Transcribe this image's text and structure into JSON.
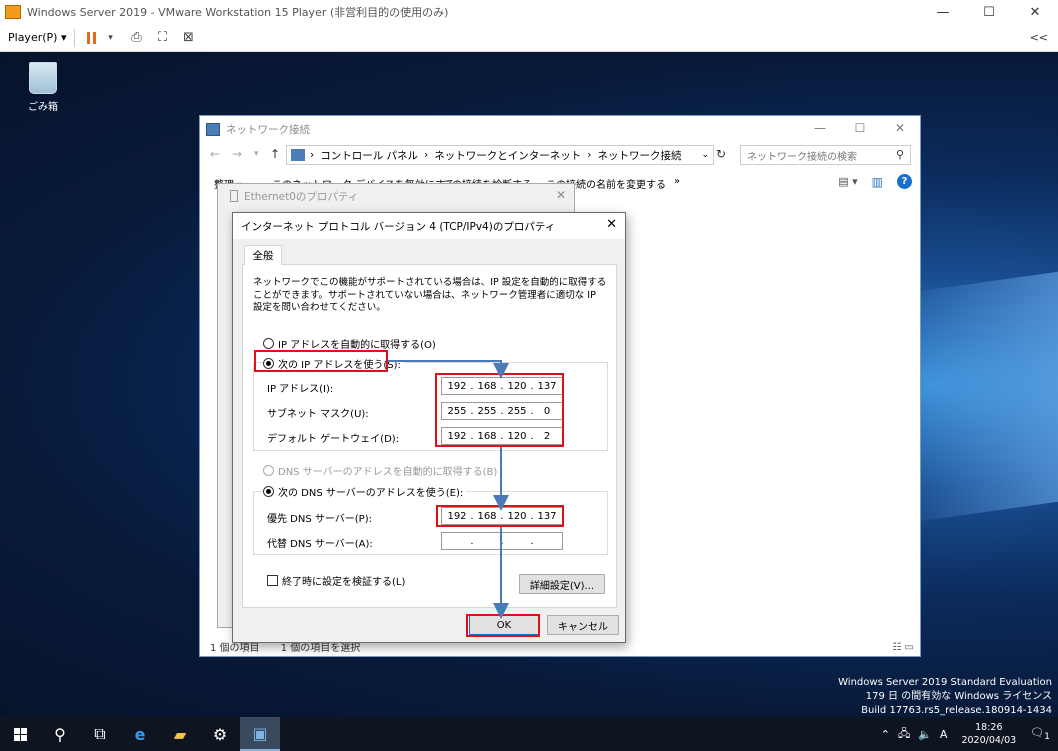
{
  "vmware": {
    "title": "Windows Server 2019 - VMware Workstation 15 Player (非営利目的の使用のみ)",
    "player_menu": "Player(P)",
    "window_controls": [
      "—",
      "☐",
      "✕"
    ],
    "collapse_icon": "<<"
  },
  "desktop": {
    "recycle_bin_label": "ごみ箱",
    "eval_line1": "Windows Server 2019 Standard Evaluation",
    "eval_line2": "179 日 の間有効な Windows ライセンス",
    "eval_line3": "Build 17763.rs5_release.180914-1434"
  },
  "explorer": {
    "title": "ネットワーク接続",
    "breadcrumb": [
      "コントロール パネル",
      "ネットワークとインターネット",
      "ネットワーク接続"
    ],
    "search_placeholder": "ネットワーク接続の検索",
    "commands": [
      "整理 ▾",
      "このネットワーク デバイスを無効にする",
      "この接続を診断する",
      "この接続の名前を変更する",
      "»"
    ],
    "status_items": "1 個の項目",
    "status_selected": "1 個の項目を選択"
  },
  "ethernet_props": {
    "title": "Ethernet0のプロパティ"
  },
  "ipv4_dialog": {
    "title": "インターネット プロトコル バージョン 4 (TCP/IPv4)のプロパティ",
    "tab": "全般",
    "description": "ネットワークでこの機能がサポートされている場合は、IP 設定を自動的に取得することができます。サポートされていない場合は、ネットワーク管理者に適切な IP 設定を問い合わせてください。",
    "radio_auto_ip": "IP アドレスを自動的に取得する(O)",
    "radio_manual_ip": "次の IP アドレスを使う(S):",
    "ip_label": "IP アドレス(I):",
    "ip_value": [
      "192",
      "168",
      "120",
      "137"
    ],
    "subnet_label": "サブネット マスク(U):",
    "subnet_value": [
      "255",
      "255",
      "255",
      "0"
    ],
    "gateway_label": "デフォルト ゲートウェイ(D):",
    "gateway_value": [
      "192",
      "168",
      "120",
      "2"
    ],
    "radio_auto_dns": "DNS サーバーのアドレスを自動的に取得する(B)",
    "radio_manual_dns": "次の DNS サーバーのアドレスを使う(E):",
    "preferred_dns_label": "優先 DNS サーバー(P):",
    "preferred_dns_value": [
      "192",
      "168",
      "120",
      "137"
    ],
    "alternate_dns_label": "代替 DNS サーバー(A):",
    "alternate_dns_value": [
      "",
      "",
      "",
      ""
    ],
    "validate_checkbox": "終了時に設定を検証する(L)",
    "advanced_button": "詳細設定(V)...",
    "ok_button": "OK",
    "cancel_button": "キャンセル",
    "highlight_color": "#e0101a",
    "arrow_color": "#4a7ab8"
  },
  "taskbar": {
    "time": "18:26",
    "date": "2020/04/03",
    "ime": "A",
    "notification_count": "1"
  }
}
